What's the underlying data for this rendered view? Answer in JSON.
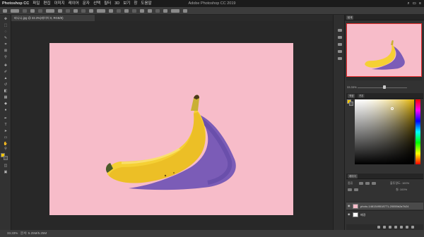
{
  "menubar": {
    "app_name": "Photoshop CC",
    "items": [
      "파일",
      "편집",
      "이미지",
      "레이어",
      "문자",
      "선택",
      "필터",
      "3D",
      "보기",
      "창",
      "도움말"
    ],
    "window_title": "Adobe Photoshop CC 2019"
  },
  "document_tab": {
    "label": "바나나.jpg @ 33.3%(레이어 0, RGB/8)"
  },
  "statusbar": {
    "zoom": "33.33%",
    "doc_info": "문서: 5.25M/5.25M"
  },
  "navigator": {
    "tab": "탐색",
    "zoom_value": "33.33%"
  },
  "color_panel": {
    "tab_color": "색상",
    "tab_swatches": "견본",
    "fg_color": "#f2c600",
    "bg_color": "#555555"
  },
  "layers_panel": {
    "tab": "레이어",
    "kind_label": "종류",
    "opacity_label": "불투명도: 100%",
    "fill_label": "칠: 100%",
    "layers": [
      {
        "name": "photo-1481349518771-20055b2a7b24",
        "visible": true,
        "selected": true
      },
      {
        "name": "배경",
        "visible": true,
        "selected": false
      }
    ]
  },
  "colors": {
    "canvas_bg": "#f7bcc9",
    "banana": "#f5d034",
    "shadow": "#6a4fb4",
    "selection": "#e72d2d"
  }
}
